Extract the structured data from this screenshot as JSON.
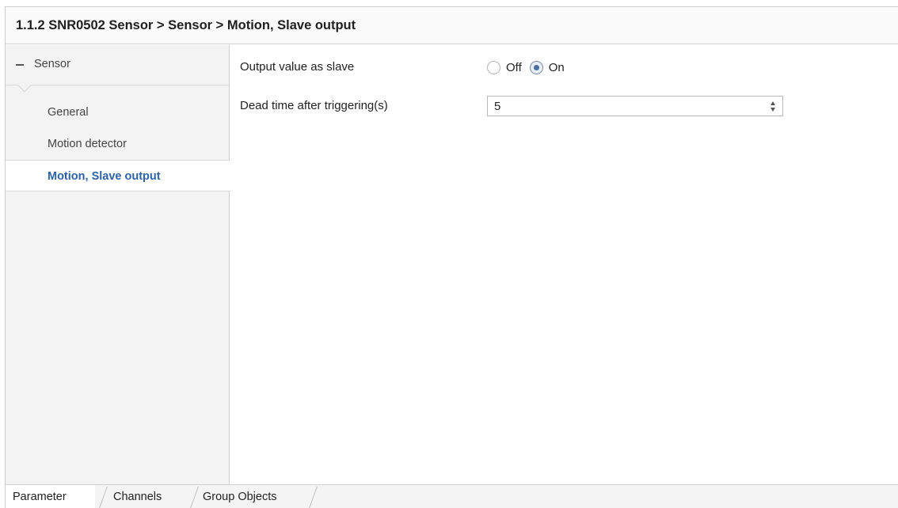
{
  "header": {
    "title": "1.1.2 SNR0502 Sensor > Sensor > Motion, Slave output"
  },
  "sidebar": {
    "group_label": "Sensor",
    "items": [
      {
        "label": "General",
        "active": false
      },
      {
        "label": "Motion detector",
        "active": false
      },
      {
        "label": "Motion, Slave output",
        "active": true
      }
    ]
  },
  "parameters": {
    "output_value": {
      "label": "Output value as slave",
      "options": [
        "Off",
        "On"
      ],
      "selected": "On"
    },
    "dead_time": {
      "label": "Dead time after triggering(s)",
      "value": "5"
    }
  },
  "tabs": [
    {
      "label": "Parameter",
      "active": true
    },
    {
      "label": "Channels",
      "active": false
    },
    {
      "label": "Group Objects",
      "active": false
    }
  ],
  "colors": {
    "active_item_text": "#2d63a5",
    "sidebar_bg": "#f3f3f3"
  }
}
